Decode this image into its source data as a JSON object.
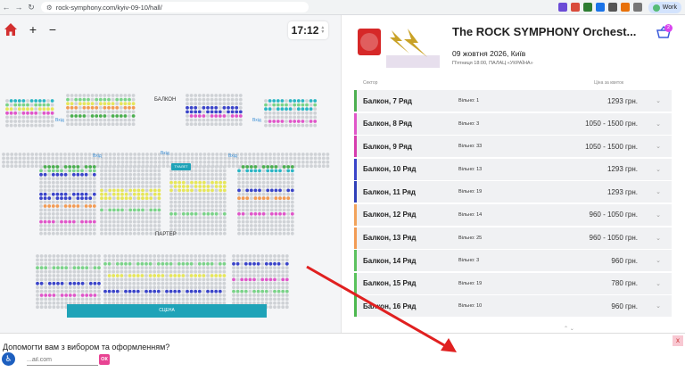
{
  "browser": {
    "url": "rock-symphony.com/kyiv-09-10/hall/",
    "profile_label": "Work",
    "back_icon": "arrow-left-icon",
    "forward_icon": "arrow-right-icon",
    "reload_icon": "reload-icon"
  },
  "seatmap": {
    "time": "17:12",
    "zoom_in": "+",
    "zoom_out": "−",
    "balcony_label": "БАЛКОН",
    "parter_label": "ПАРТЕР",
    "stage_label": "СЦЕНА",
    "toilet_label": "ТУАЛЕТ",
    "door_label": "Вхід"
  },
  "event": {
    "title": "The ROCK SYMPHONY Orchest...",
    "date": "09 жовтня 2026, Київ",
    "venue": "П'ятниця 18:00, ПАЛАЦ «УКРАЇНА»",
    "cart_count": "2",
    "col_sector": "Сектор",
    "col_price": "Ціна за квиток"
  },
  "sectors": [
    {
      "name": "Балкон, 7 Ряд",
      "available": "Вільно: 1",
      "price": "1293 грн.",
      "color": "#4caf50"
    },
    {
      "name": "Балкон, 8 Ряд",
      "available": "Вільно: 3",
      "price": "1050 - 1500 грн.",
      "color": "#e056c9"
    },
    {
      "name": "Балкон, 9 Ряд",
      "available": "Вільно: 33",
      "price": "1050 - 1500 грн.",
      "color": "#d63cae"
    },
    {
      "name": "Балкон, 10 Ряд",
      "available": "Вільно: 13",
      "price": "1293 грн.",
      "color": "#3a44c9"
    },
    {
      "name": "Балкон, 11 Ряд",
      "available": "Вільно: 19",
      "price": "1293 грн.",
      "color": "#2f3fb8"
    },
    {
      "name": "Балкон, 12 Ряд",
      "available": "Вільно: 14",
      "price": "960 - 1050 грн.",
      "color": "#f2a35b"
    },
    {
      "name": "Балкон, 13 Ряд",
      "available": "Вільно: 25",
      "price": "960 - 1050 грн.",
      "color": "#f29b54"
    },
    {
      "name": "Балкон, 14 Ряд",
      "available": "Вільно: 3",
      "price": "960 грн.",
      "color": "#5cc15f"
    },
    {
      "name": "Балкон, 15 Ряд",
      "available": "Вільно: 19",
      "price": "780 грн.",
      "color": "#59c25c"
    },
    {
      "name": "Балкон, 16 Ряд",
      "available": "Вільно: 10",
      "price": "960 грн.",
      "color": "#4cb84f"
    }
  ],
  "help": {
    "question": "Допомогти вам з вибором та оформленням?",
    "input_placeholder": "...ail.com",
    "ok_label": "ОК",
    "close_label": "x"
  }
}
